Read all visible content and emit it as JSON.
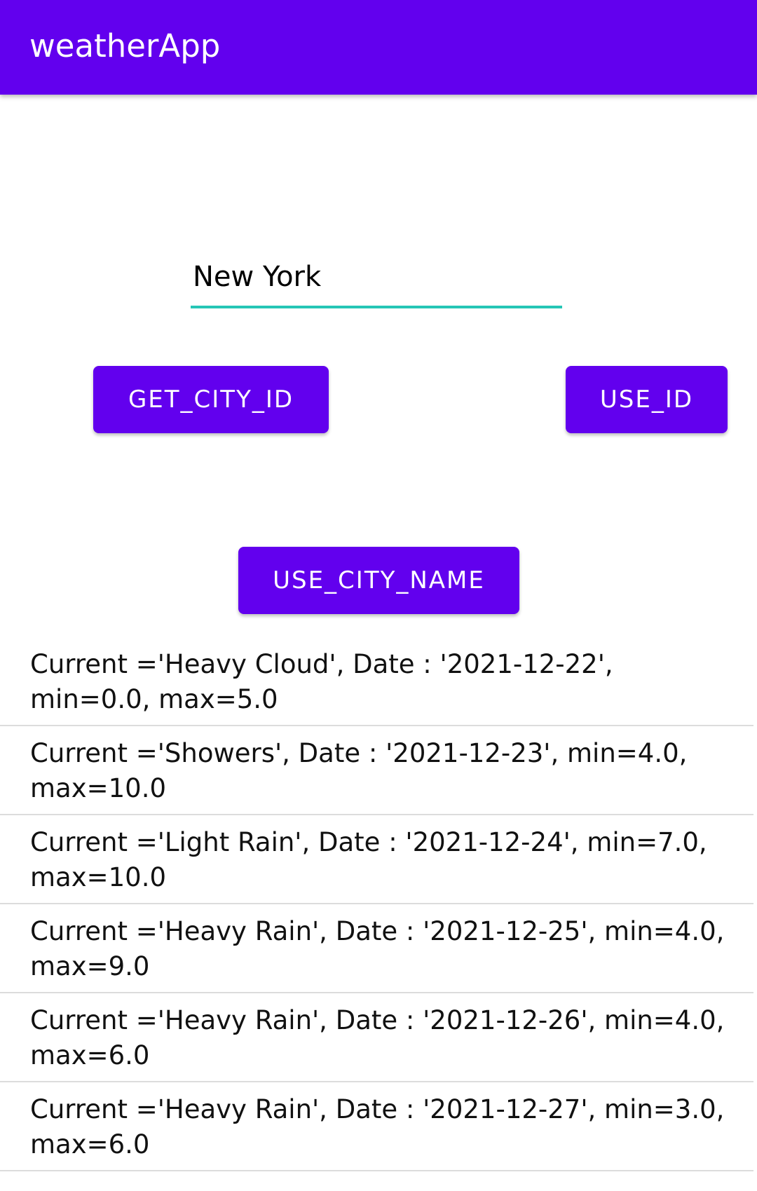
{
  "app_bar": {
    "title": "weatherApp",
    "color": "#6200ee"
  },
  "search": {
    "value": "New York",
    "underline_color": "#26c6b6"
  },
  "buttons": {
    "get_city_id": "GET_CITY_ID",
    "use_id": "USE_ID",
    "use_city_name": "USE_CITY_NAME"
  },
  "forecast": [
    {
      "text": "Current ='Heavy Cloud', Date : '2021-12-22', min=0.0, max=5.0"
    },
    {
      "text": "Current ='Showers', Date : '2021-12-23', min=4.0, max=10.0"
    },
    {
      "text": "Current ='Light Rain', Date : '2021-12-24', min=7.0, max=10.0"
    },
    {
      "text": "Current ='Heavy Rain', Date : '2021-12-25', min=4.0, max=9.0"
    },
    {
      "text": "Current ='Heavy Rain', Date : '2021-12-26', min=4.0, max=6.0"
    },
    {
      "text": "Current ='Heavy Rain', Date : '2021-12-27', min=3.0, max=6.0"
    }
  ]
}
